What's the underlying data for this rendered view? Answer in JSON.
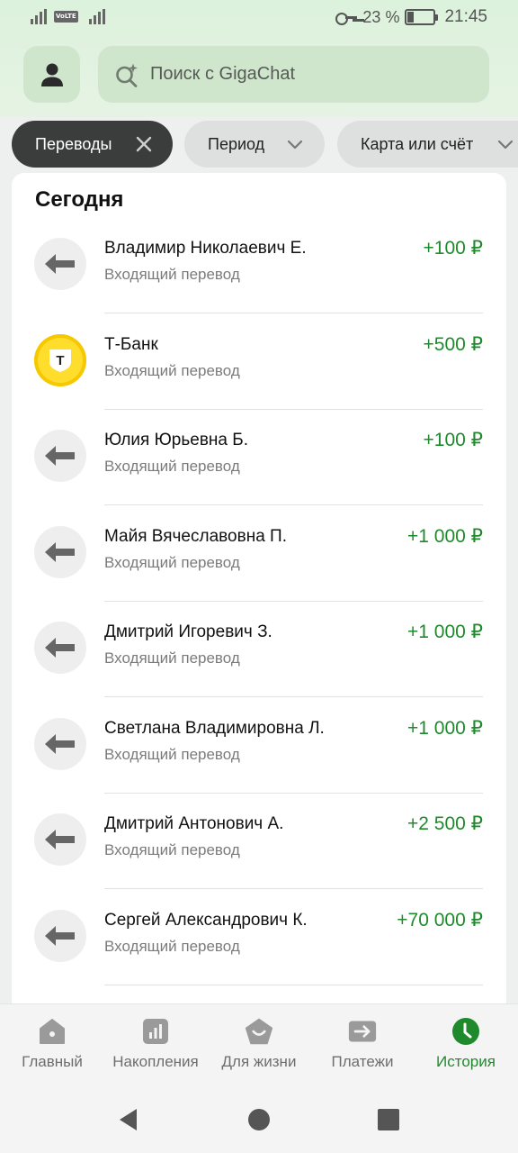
{
  "status_bar": {
    "volte_label": "VoLTE",
    "battery_percent": "23 %",
    "battery_level": 0.23,
    "time": "21:45"
  },
  "header": {
    "profile_icon": "user-icon",
    "search_icon": "gigachat-search-icon",
    "search_placeholder": "Поиск с GigaChat"
  },
  "filters": [
    {
      "label": "Переводы",
      "active": true,
      "icon": "close-icon"
    },
    {
      "label": "Период",
      "active": false,
      "icon": "chevron-down-icon"
    },
    {
      "label": "Карта или счёт",
      "active": false,
      "icon": "chevron-down-icon"
    }
  ],
  "section_title": "Сегодня",
  "transactions": [
    {
      "name": "Владимир Николаевич Е.",
      "subtitle": "Входящий перевод",
      "amount": "+100 ₽",
      "icon": "incoming-arrow-icon"
    },
    {
      "name": "Т-Банк",
      "subtitle": "Входящий перевод",
      "amount": "+500 ₽",
      "icon": "tbank-logo-icon",
      "logo_letter": "Т"
    },
    {
      "name": "Юлия Юрьевна Б.",
      "subtitle": "Входящий перевод",
      "amount": "+100 ₽",
      "icon": "incoming-arrow-icon"
    },
    {
      "name": "Майя Вячеславовна П.",
      "subtitle": "Входящий перевод",
      "amount": "+1 000 ₽",
      "icon": "incoming-arrow-icon"
    },
    {
      "name": "Дмитрий Игоревич З.",
      "subtitle": "Входящий перевод",
      "amount": "+1 000 ₽",
      "icon": "incoming-arrow-icon"
    },
    {
      "name": "Светлана Владимировна Л.",
      "subtitle": "Входящий перевод",
      "amount": "+1 000 ₽",
      "icon": "incoming-arrow-icon"
    },
    {
      "name": "Дмитрий Антонович А.",
      "subtitle": "Входящий перевод",
      "amount": "+2 500 ₽",
      "icon": "incoming-arrow-icon"
    },
    {
      "name": "Сергей Александрович К.",
      "subtitle": "Входящий перевод",
      "amount": "+70 000 ₽",
      "icon": "incoming-arrow-icon"
    }
  ],
  "bottom_nav": [
    {
      "label": "Главный",
      "icon": "home-icon",
      "active": false
    },
    {
      "label": "Накопления",
      "icon": "savings-chart-icon",
      "active": false
    },
    {
      "label": "Для жизни",
      "icon": "lifestyle-icon",
      "active": false
    },
    {
      "label": "Платежи",
      "icon": "payments-arrow-icon",
      "active": false
    },
    {
      "label": "История",
      "icon": "history-clock-icon",
      "active": true
    }
  ],
  "colors": {
    "accent_green": "#1f8a2c",
    "amount_green": "#1f8a2c",
    "header_bg": "#dcf2dc",
    "chip_active_bg": "#3a3d3c",
    "tbank_yellow": "#ffdd2d"
  }
}
